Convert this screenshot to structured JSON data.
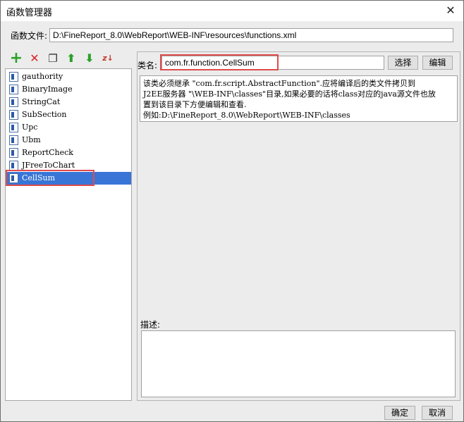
{
  "window": {
    "title": "函数管理器"
  },
  "file": {
    "label": "函数文件:",
    "path": "D:\\FineReport_8.0\\WebReport\\WEB-INF\\resources\\functions.xml"
  },
  "toolbar": {
    "add_symbol": "+",
    "delete_symbol": "✕",
    "copy_symbol": "❐",
    "up_symbol": "⬆",
    "down_symbol": "⬇",
    "sort_symbol": "z↓"
  },
  "functions": [
    {
      "name": "gauthority"
    },
    {
      "name": "BinaryImage"
    },
    {
      "name": "StringCat"
    },
    {
      "name": "SubSection"
    },
    {
      "name": "Upc"
    },
    {
      "name": "Ubm"
    },
    {
      "name": "ReportCheck"
    },
    {
      "name": "JFreeToChart"
    },
    {
      "name": "CellSum",
      "selected": true
    }
  ],
  "classname": {
    "label": "类名:",
    "value": "com.fr.function.CellSum",
    "choose_label": "选择",
    "edit_label": "编辑"
  },
  "info": {
    "line1": "该类必须继承 \"com.fr.script.AbstractFunction\".应将编译后的类文件拷贝到",
    "line2": "J2EE服务器 \"\\WEB-INF\\classes\"目录,如果必要的话将class对应的java源文件也放",
    "line3": "置到该目录下方便编辑和查看.",
    "line4": "例如:D:\\FineReport_8.0\\WebReport\\WEB-INF\\classes"
  },
  "description": {
    "label": "描述:",
    "value": ""
  },
  "footer": {
    "ok_label": "确定",
    "cancel_label": "取消"
  },
  "colors": {
    "selection": "#3875d7",
    "highlight": "#e14b4b",
    "add": "#2aa12a",
    "delete": "#d9232a",
    "arrows": "#2aa12a"
  }
}
